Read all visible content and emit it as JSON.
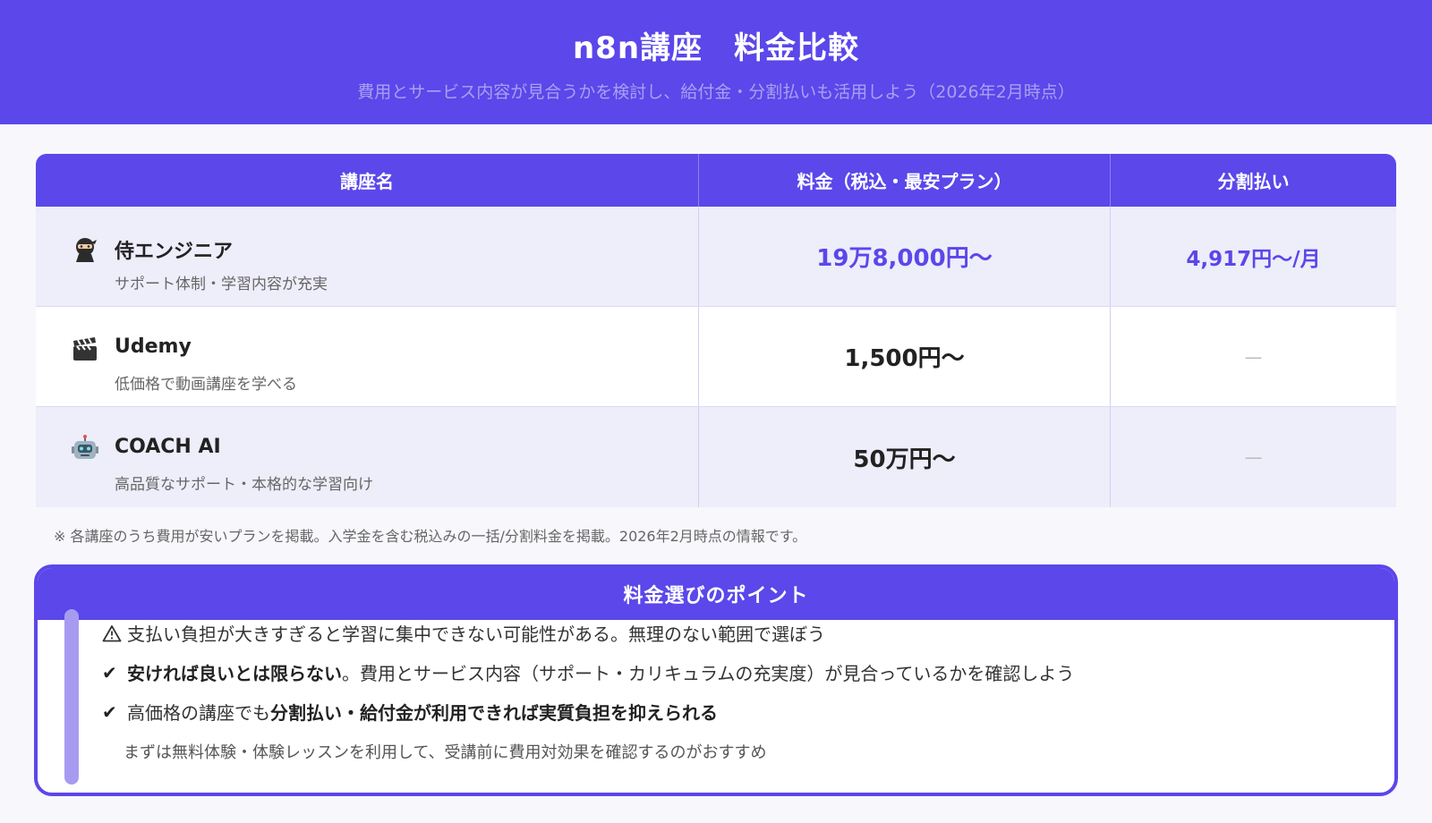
{
  "header": {
    "title": "n8n講座　料金比較",
    "subtitle": "費用とサービス内容が見合うかを検討し、給付金・分割払いも活用しよう（2026年2月時点）"
  },
  "table": {
    "columns": [
      "講座名",
      "料金（税込・最安プラン）",
      "分割払い"
    ],
    "rows": [
      {
        "icon": "ninja-icon",
        "name": "侍エンジニア",
        "desc": "サポート体制・学習内容が充実",
        "price": "19万8,000円〜",
        "installment": "4,917円〜/月"
      },
      {
        "icon": "clapper-board-icon",
        "name": "Udemy",
        "desc": "低価格で動画講座を学べる",
        "price": "1,500円〜",
        "installment": "—"
      },
      {
        "icon": "robot-icon",
        "name": "COACH AI",
        "desc": "高品質なサポート・本格的な学習向け",
        "price": "50万円〜",
        "installment": "—"
      }
    ]
  },
  "note": "※ 各講座のうち費用が安いプランを掲載。入学金を含む税込みの一括/分割料金を掲載。2026年2月時点の情報です。",
  "points": {
    "title": "料金選びのポイント",
    "p1": {
      "icon": "warning-icon",
      "text": "支払い負担が大きすぎると学習に集中できない可能性がある。無理のない範囲で選ぼう"
    },
    "p2": {
      "mark": "✔",
      "bold": "安ければ良いとは限らない",
      "text": "。費用とサービス内容（サポート・カリキュラムの充実度）が見合っているかを確認しよう"
    },
    "p3": {
      "mark": "✔",
      "pre": "高価格の講座でも",
      "bold": "分割払い・給付金が利用できれば実質負担を抑えられる"
    },
    "p4": {
      "text": "まずは無料体験・体験レッスンを利用して、受講前に費用対効果を確認するのがおすすめ"
    }
  },
  "colors": {
    "accent": "#5b47ea",
    "row_alt": "#eeedfa",
    "bar": "#a79bf1"
  }
}
